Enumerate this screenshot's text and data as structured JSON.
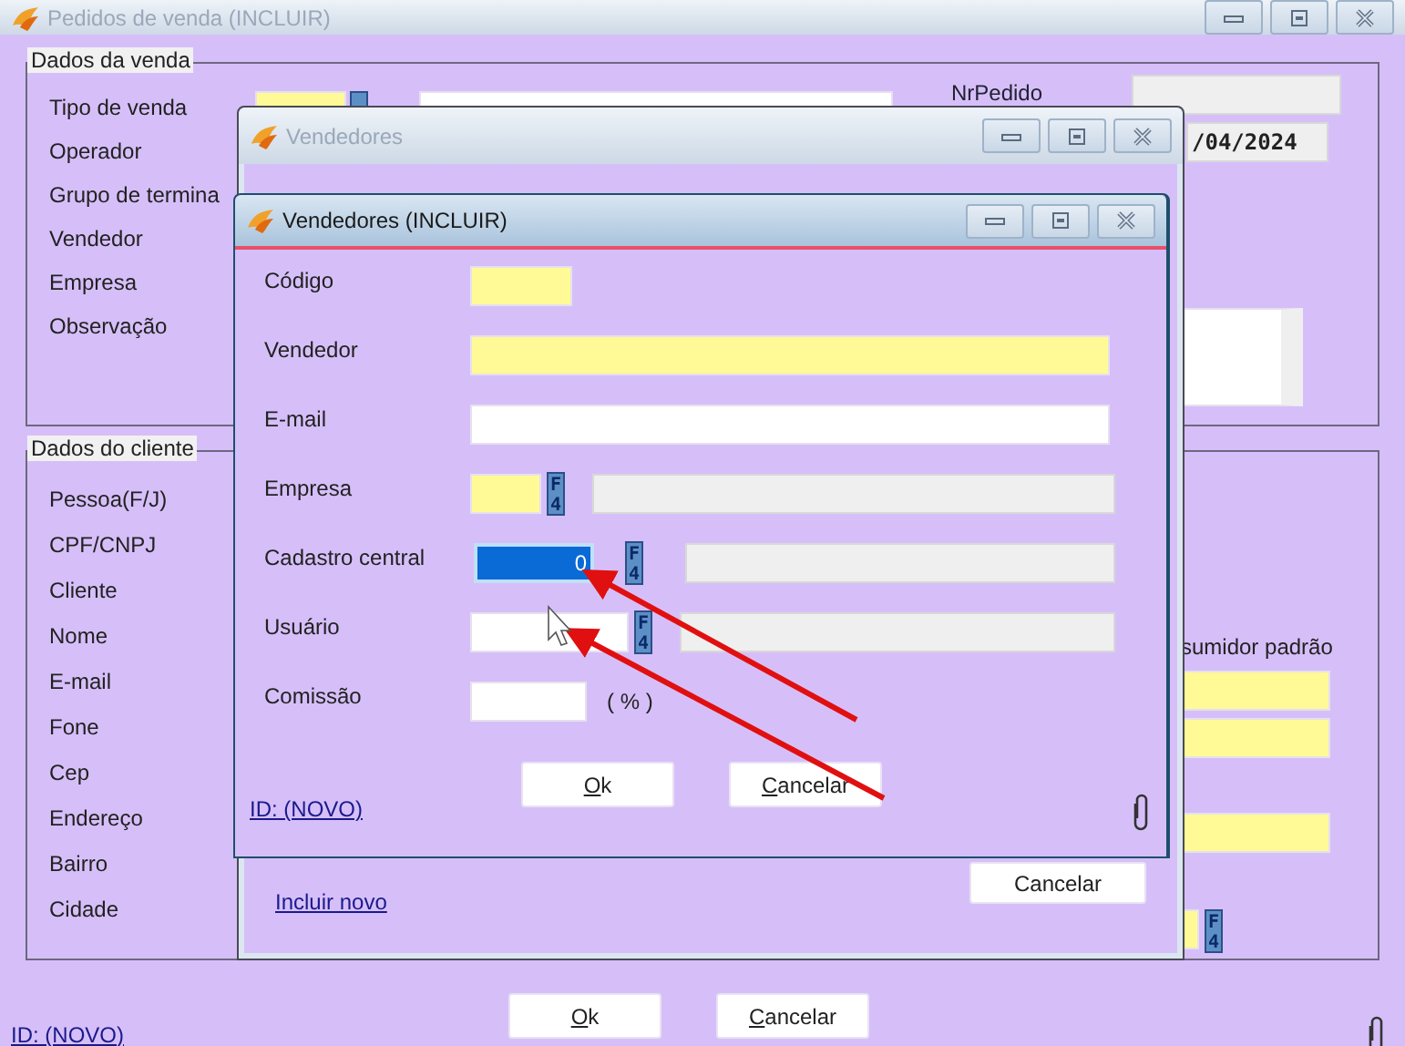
{
  "main_window": {
    "title": "Pedidos de venda (INCLUIR)",
    "active": false,
    "sale_group": {
      "title": "Dados da venda",
      "labels": [
        "Tipo de venda",
        "Operador",
        "Grupo de termina",
        "Vendedor",
        "Empresa",
        "Observação"
      ],
      "order_number_label": "NrPedido",
      "date_value": "/04/2024"
    },
    "client_group": {
      "title": "Dados do cliente",
      "labels": [
        "Pessoa(F/J)",
        "CPF/CNPJ",
        "Cliente",
        "Nome",
        "E-mail",
        "Fone",
        "Cep",
        "Endereço",
        "Bairro",
        "Cidade"
      ],
      "consumer_label": "sumidor padrão",
      "fields": [
        {
          "kind": "plain",
          "required": true
        },
        {
          "kind": "plain",
          "required": true
        },
        {
          "kind": "plain",
          "required": true
        },
        {
          "kind": "lookup",
          "required": true,
          "key": "F4"
        }
      ]
    },
    "id_link": "ID: (NOVO)",
    "buttons": [
      {
        "label": "Ok",
        "mnemonic": true
      },
      {
        "label": "Cancelar",
        "mnemonic": true
      }
    ]
  },
  "sellers_window": {
    "title": "Vendedores",
    "active": false,
    "new_link": "Incluir novo",
    "buttons": [
      {
        "label": "Cancelar",
        "mnemonic": false
      }
    ]
  },
  "seller_form": {
    "title": "Vendedores (INCLUIR)",
    "active": true,
    "rows": [
      {
        "label": "Código",
        "kind": "code",
        "required": true,
        "focused": false
      },
      {
        "label": "Vendedor",
        "kind": "wide",
        "required": true,
        "focused": false
      },
      {
        "label": "E-mail",
        "kind": "wide",
        "required": false,
        "focused": false
      },
      {
        "label": "Empresa",
        "kind": "lookup",
        "required": true,
        "focused": false,
        "key": "F4"
      },
      {
        "label": "Cadastro central",
        "kind": "lookup",
        "required": false,
        "focused": true,
        "key": "F4",
        "value": "0"
      },
      {
        "label": "Usuário",
        "kind": "lookup",
        "required": false,
        "focused": false,
        "key": "F4"
      },
      {
        "label": "Comissão",
        "kind": "percent",
        "required": false,
        "focused": false,
        "suffix": "( % )"
      }
    ],
    "id_link": "ID: (NOVO)",
    "buttons": [
      {
        "label": "Ok",
        "mnemonic": true
      },
      {
        "label": "Cancelar",
        "mnemonic": true
      }
    ]
  }
}
